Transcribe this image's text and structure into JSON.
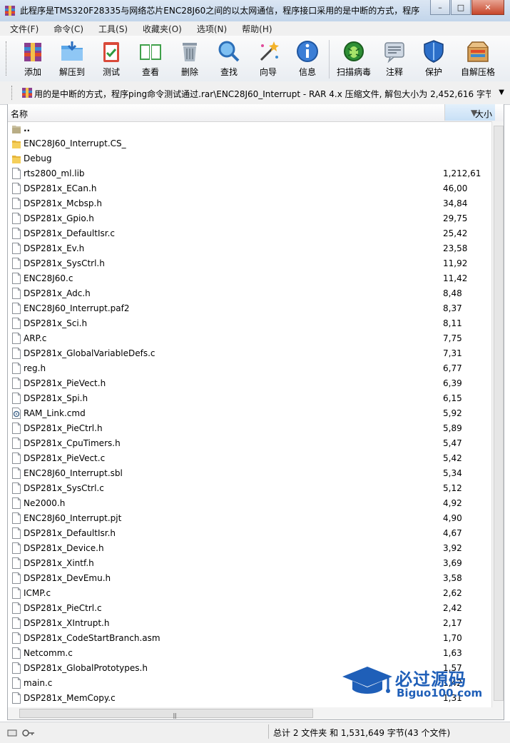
{
  "window": {
    "title": "此程序是TMS320F28335与网络芯片ENC28J60之间的以太网通信，程序接口采用的是中断的方式，程序...",
    "minimize": "–",
    "maximize": "□",
    "close": "✕"
  },
  "menu": [
    "文件(F)",
    "命令(C)",
    "工具(S)",
    "收藏夹(O)",
    "选项(N)",
    "帮助(H)"
  ],
  "toolbar": {
    "add": "添加",
    "extract": "解压到",
    "test": "测试",
    "view": "查看",
    "delete": "删除",
    "find": "查找",
    "wizard": "向导",
    "info": "信息",
    "virus": "扫描病毒",
    "comment": "注释",
    "protect": "保护",
    "sfx": "自解压格"
  },
  "address": {
    "path": "用的是中断的方式，程序ping命令测试通过.rar\\ENC28J60_Interrupt - RAR 4.x 压缩文件, 解包大小为 2,452,616 字节"
  },
  "columns": {
    "name": "名称",
    "size": "大小"
  },
  "files": [
    {
      "name": "..",
      "size": "",
      "type": "parent"
    },
    {
      "name": "ENC28J60_Interrupt.CS_",
      "size": "",
      "type": "folder"
    },
    {
      "name": "Debug",
      "size": "",
      "type": "folder"
    },
    {
      "name": "rts2800_ml.lib",
      "size": "1,212,61",
      "type": "file"
    },
    {
      "name": "DSP281x_ECan.h",
      "size": "46,00",
      "type": "file"
    },
    {
      "name": "DSP281x_Mcbsp.h",
      "size": "34,84",
      "type": "file"
    },
    {
      "name": "DSP281x_Gpio.h",
      "size": "29,75",
      "type": "file"
    },
    {
      "name": "DSP281x_DefaultIsr.c",
      "size": "25,42",
      "type": "file"
    },
    {
      "name": "DSP281x_Ev.h",
      "size": "23,58",
      "type": "file"
    },
    {
      "name": "DSP281x_SysCtrl.h",
      "size": "11,92",
      "type": "file"
    },
    {
      "name": "ENC28J60.c",
      "size": "11,42",
      "type": "file"
    },
    {
      "name": "DSP281x_Adc.h",
      "size": "8,48",
      "type": "file"
    },
    {
      "name": "ENC28J60_Interrupt.paf2",
      "size": "8,37",
      "type": "file"
    },
    {
      "name": "DSP281x_Sci.h",
      "size": "8,11",
      "type": "file"
    },
    {
      "name": "ARP.c",
      "size": "7,75",
      "type": "file"
    },
    {
      "name": "DSP281x_GlobalVariableDefs.c",
      "size": "7,31",
      "type": "file"
    },
    {
      "name": "reg.h",
      "size": "6,77",
      "type": "file"
    },
    {
      "name": "DSP281x_PieVect.h",
      "size": "6,39",
      "type": "file"
    },
    {
      "name": "DSP281x_Spi.h",
      "size": "6,15",
      "type": "file"
    },
    {
      "name": "RAM_Link.cmd",
      "size": "5,92",
      "type": "cmd"
    },
    {
      "name": "DSP281x_PieCtrl.h",
      "size": "5,89",
      "type": "file"
    },
    {
      "name": "DSP281x_CpuTimers.h",
      "size": "5,47",
      "type": "file"
    },
    {
      "name": "DSP281x_PieVect.c",
      "size": "5,42",
      "type": "file"
    },
    {
      "name": "ENC28J60_Interrupt.sbl",
      "size": "5,34",
      "type": "file"
    },
    {
      "name": "DSP281x_SysCtrl.c",
      "size": "5,12",
      "type": "file"
    },
    {
      "name": "Ne2000.h",
      "size": "4,92",
      "type": "file"
    },
    {
      "name": "ENC28J60_Interrupt.pjt",
      "size": "4,90",
      "type": "file"
    },
    {
      "name": "DSP281x_DefaultIsr.h",
      "size": "4,67",
      "type": "file"
    },
    {
      "name": "DSP281x_Device.h",
      "size": "3,92",
      "type": "file"
    },
    {
      "name": "DSP281x_Xintf.h",
      "size": "3,69",
      "type": "file"
    },
    {
      "name": "DSP281x_DevEmu.h",
      "size": "3,58",
      "type": "file"
    },
    {
      "name": "ICMP.c",
      "size": "2,62",
      "type": "file"
    },
    {
      "name": "DSP281x_PieCtrl.c",
      "size": "2,42",
      "type": "file"
    },
    {
      "name": "DSP281x_XIntrupt.h",
      "size": "2,17",
      "type": "file"
    },
    {
      "name": "DSP281x_CodeStartBranch.asm",
      "size": "1,70",
      "type": "file"
    },
    {
      "name": "Netcomm.c",
      "size": "1,63",
      "type": "file"
    },
    {
      "name": "DSP281x_GlobalPrototypes.h",
      "size": "1,57",
      "type": "file"
    },
    {
      "name": "main.c",
      "size": "1,42",
      "type": "file"
    },
    {
      "name": "DSP281x_MemCopy.c",
      "size": "1,31",
      "type": "file"
    }
  ],
  "status": {
    "summary": "总计 2 文件夹 和 1,531,649 字节(43 个文件)"
  },
  "watermark": {
    "cn": "必过源码",
    "en": "Biguo100.com"
  }
}
